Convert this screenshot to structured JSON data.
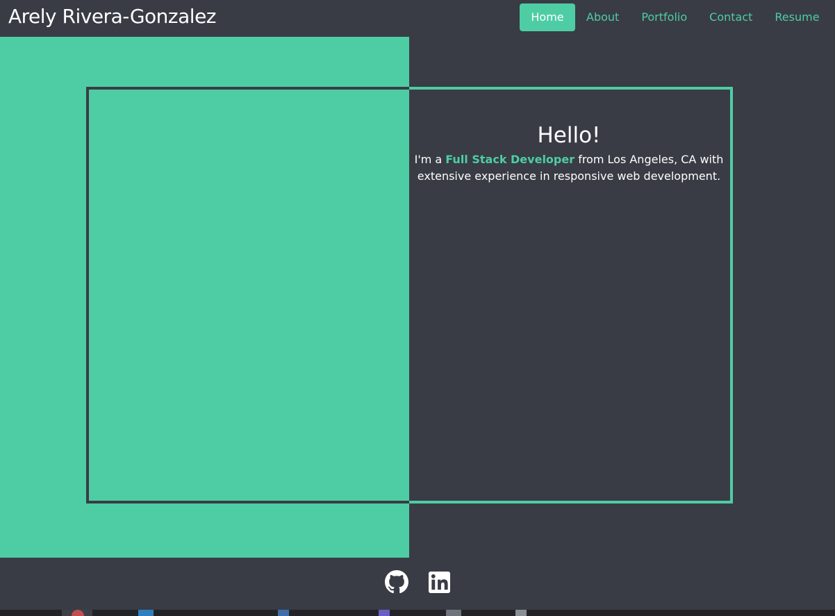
{
  "header": {
    "brand": "Arely Rivera-Gonzalez",
    "nav": [
      {
        "label": "Home",
        "active": true
      },
      {
        "label": "About",
        "active": false
      },
      {
        "label": "Portfolio",
        "active": false
      },
      {
        "label": "Contact",
        "active": false
      },
      {
        "label": "Resume",
        "active": false
      }
    ]
  },
  "intro": {
    "heading": "Hello!",
    "bio_prefix": "I'm a ",
    "bio_role": "Full Stack Developer",
    "bio_suffix": " from Los Angeles, CA with extensive experience in responsive web development."
  },
  "socials": [
    {
      "icon": "github-icon"
    },
    {
      "icon": "linkedin-icon"
    }
  ],
  "colors": {
    "background": "#393c45",
    "accent": "#4ecda4",
    "text": "#ffffff"
  }
}
